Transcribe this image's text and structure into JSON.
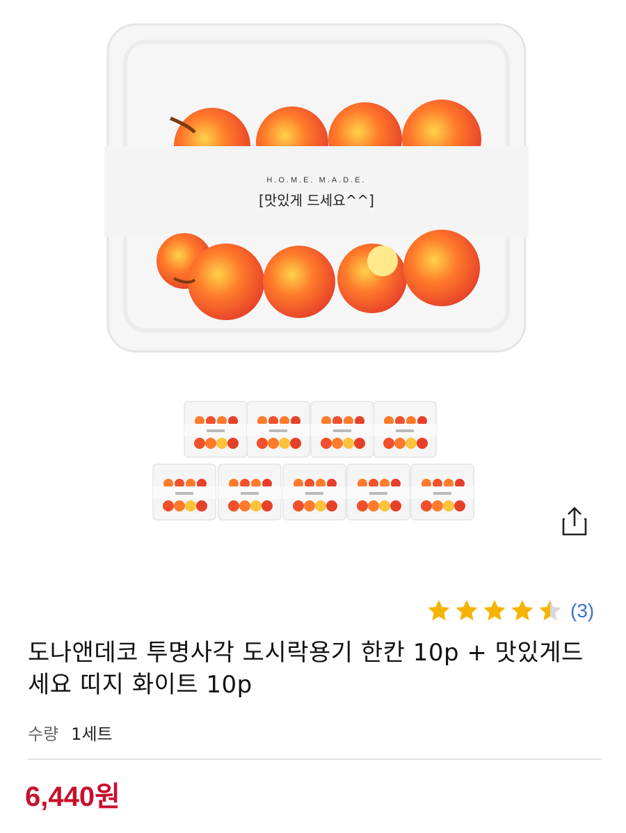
{
  "product": {
    "image_label_top": "H.O.M.E. M.A.D.E.",
    "image_label_main": "[맛있게 드세요^^]",
    "title": "도나앤데코 투명사각 도시락용기 한칸 10p + 맛있게드세요 띠지 화이트 10p",
    "rating": 4.5,
    "review_count": "(3)",
    "quantity_label": "수량",
    "quantity_value": "1세트",
    "price": "6,440원"
  },
  "colors": {
    "star": "#f5b301",
    "price": "#c8102e",
    "link": "#3d6fd4"
  },
  "icons": {
    "share": "share-icon",
    "star": "star-icon"
  }
}
